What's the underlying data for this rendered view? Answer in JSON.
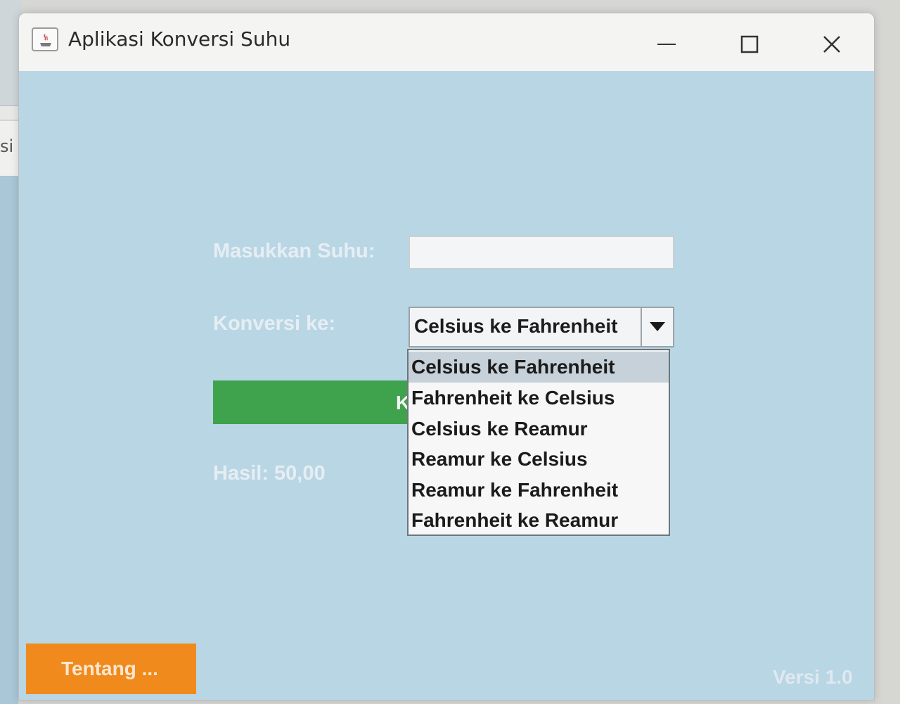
{
  "background": {
    "partial_text": "si"
  },
  "window": {
    "title": "Aplikasi Konversi Suhu",
    "controls": [
      "minimize",
      "maximize",
      "close"
    ]
  },
  "form": {
    "suhu_label": "Masukkan Suhu:",
    "suhu_value": "",
    "konversi_label": "Konversi ke:",
    "konversi_selected": "Celsius ke Fahrenheit",
    "convert_button_visible_label": "K",
    "hasil_label": "Hasil: 50,00"
  },
  "dropdown": {
    "open": true,
    "options": [
      "Celsius ke Fahrenheit",
      "Fahrenheit ke Celsius",
      "Celsius ke Reamur",
      "Reamur ke Celsius",
      "Reamur ke Fahrenheit",
      "Fahrenheit ke Reamur"
    ],
    "highlighted_index": 0
  },
  "footer": {
    "tentang_label": "Tentang ...",
    "versi_label": "Versi 1.0"
  },
  "colors": {
    "client_bg": "#b9d6e5",
    "green_button": "#3fa34d",
    "orange_button": "#f08a1c",
    "label_text": "#e6eef3"
  }
}
